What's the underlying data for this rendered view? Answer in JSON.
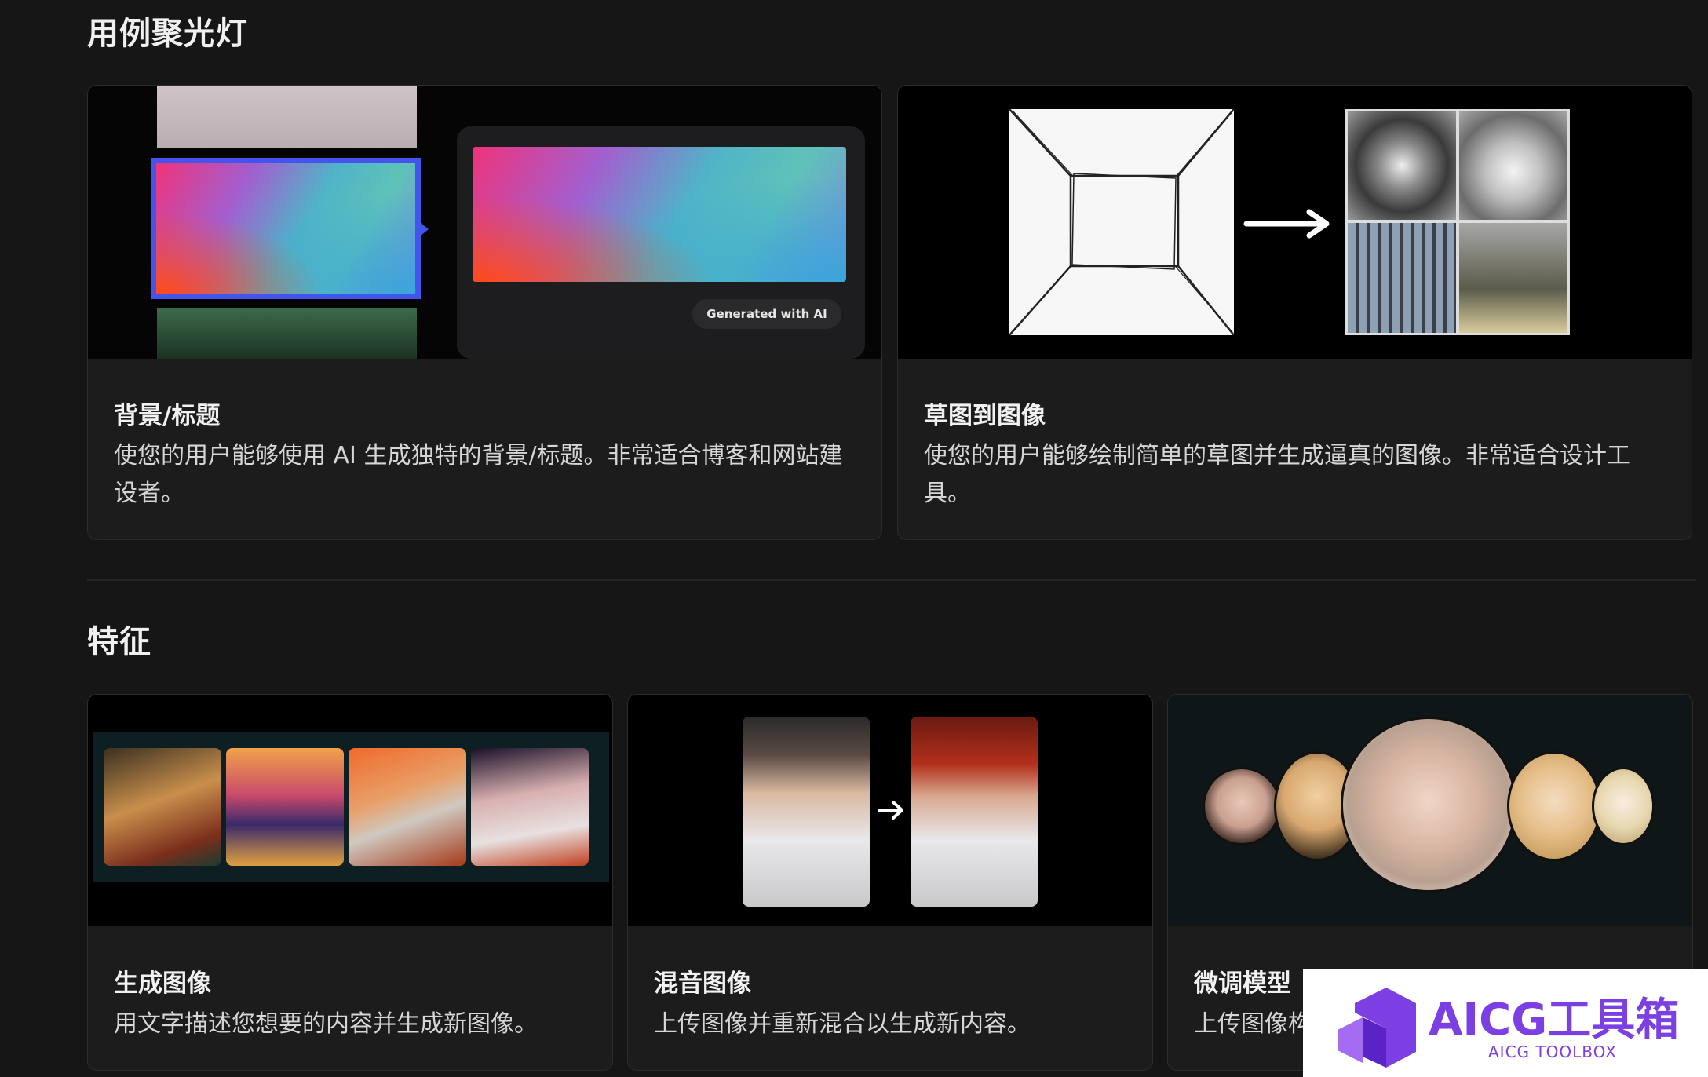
{
  "spotlight": {
    "heading": "用例聚光灯",
    "cards": [
      {
        "title": "背景/标题",
        "desc": "使您的用户能够使用 AI 生成独特的背景/标题。非常适合博客和网站建设者。",
        "badge": "Generated with AI"
      },
      {
        "title": "草图到图像",
        "desc": "使您的用户能够绘制简单的草图并生成逼真的图像。非常适合设计工具。"
      }
    ]
  },
  "features": {
    "heading": "特征",
    "cards": [
      {
        "title": "生成图像",
        "desc": "用文字描述您想要的内容并生成新图像。"
      },
      {
        "title": "混音图像",
        "desc": "上传图像并重新混合以生成新内容。"
      },
      {
        "title": "微调模型",
        "desc": "上传图像构"
      }
    ]
  },
  "watermark": {
    "brand": "AICG工具箱",
    "sub": "AICG TOOLBOX",
    "color": "#7b3fe4"
  }
}
